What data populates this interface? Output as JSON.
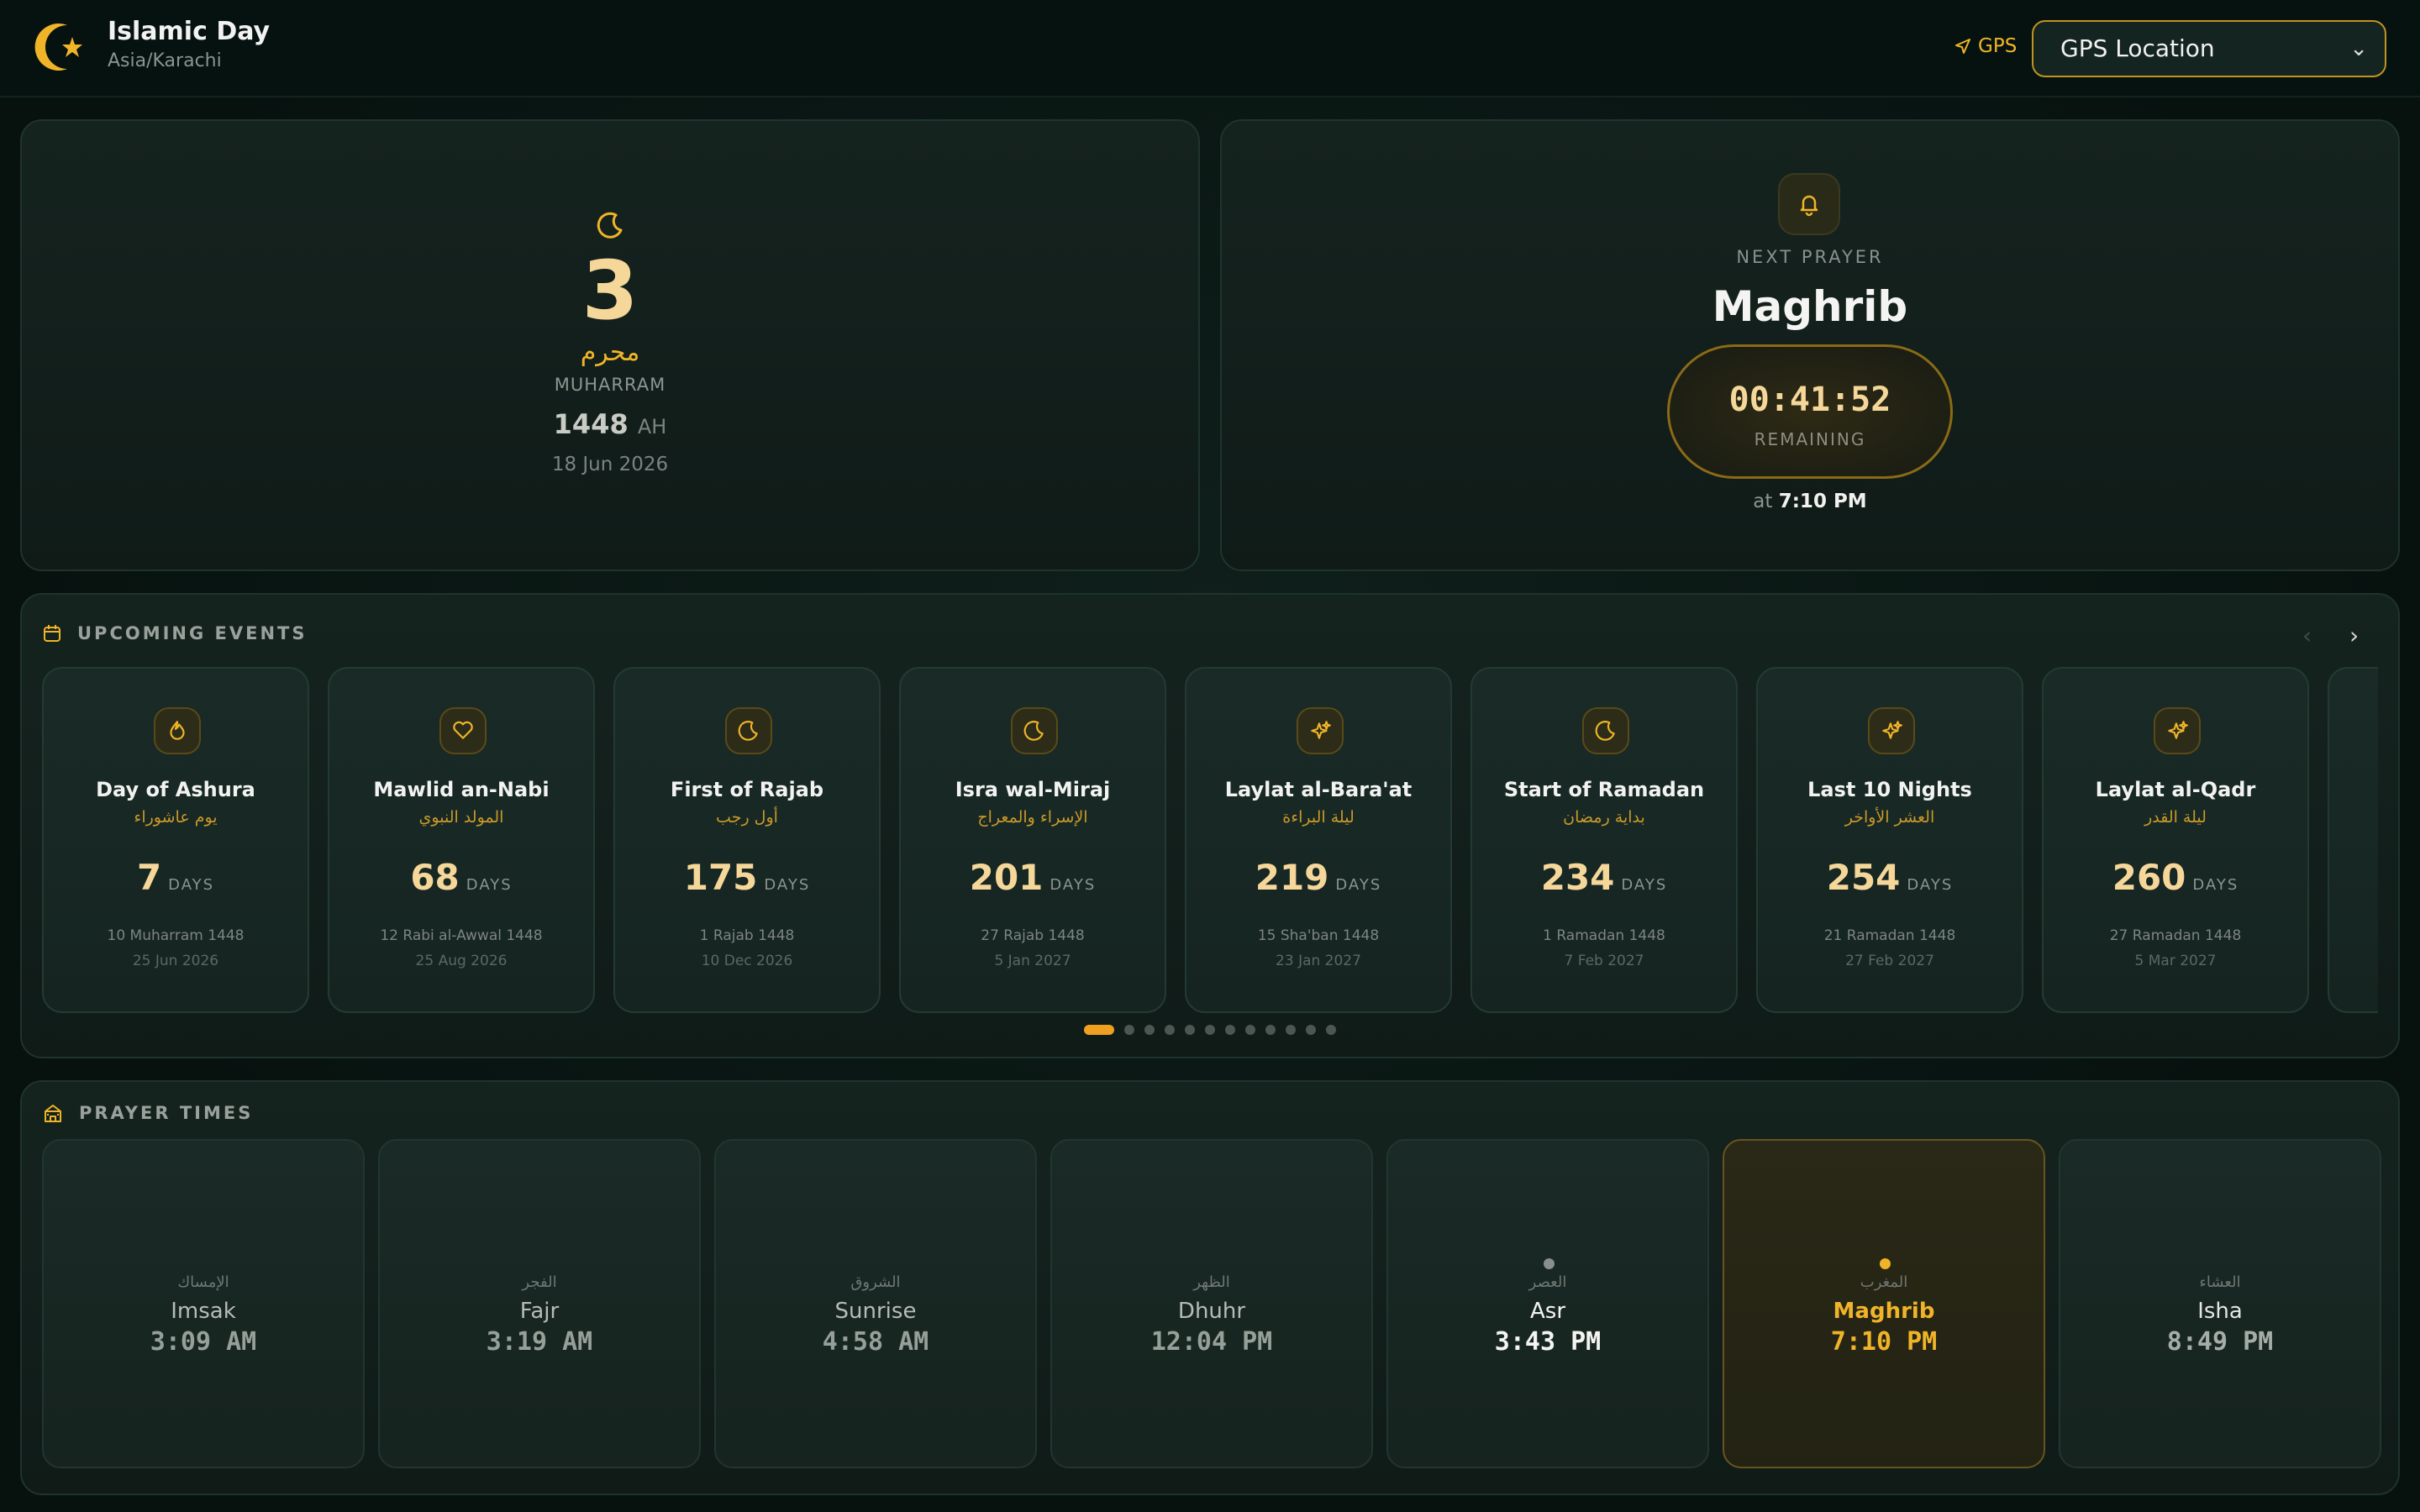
{
  "app": {
    "title": "Islamic Day",
    "timezone": "Asia/Karachi"
  },
  "location": {
    "gps_label": "GPS",
    "selected": "GPS Location"
  },
  "hijri": {
    "day": "3",
    "month_ar": "محرم",
    "month_en": "MUHARRAM",
    "year": "1448",
    "era": "AH",
    "gregorian": "18 Jun 2026"
  },
  "next_prayer": {
    "label": "NEXT PRAYER",
    "name": "Maghrib",
    "countdown": "00:41:52",
    "remaining_label": "REMAINING",
    "at_prefix": "at",
    "at_time": "7:10 PM"
  },
  "events": {
    "title": "UPCOMING EVENTS",
    "days_unit": "DAYS",
    "items": [
      {
        "icon": "flame-icon",
        "name": "Day of Ashura",
        "ar": "يوم عاشوراء",
        "days": "7",
        "hijri": "10 Muharram 1448",
        "greg": "25 Jun 2026"
      },
      {
        "icon": "heart-icon",
        "name": "Mawlid an-Nabi",
        "ar": "المولد النبوي",
        "days": "68",
        "hijri": "12 Rabi al-Awwal 1448",
        "greg": "25 Aug 2026"
      },
      {
        "icon": "moon-icon",
        "name": "First of Rajab",
        "ar": "أول رجب",
        "days": "175",
        "hijri": "1 Rajab 1448",
        "greg": "10 Dec 2026"
      },
      {
        "icon": "moon-icon",
        "name": "Isra wal-Miraj",
        "ar": "الإسراء والمعراج",
        "days": "201",
        "hijri": "27 Rajab 1448",
        "greg": "5 Jan 2027"
      },
      {
        "icon": "sparkles-icon",
        "name": "Laylat al-Bara'at",
        "ar": "ليلة البراءة",
        "days": "219",
        "hijri": "15 Sha'ban 1448",
        "greg": "23 Jan 2027"
      },
      {
        "icon": "moon-icon",
        "name": "Start of Ramadan",
        "ar": "بداية رمضان",
        "days": "234",
        "hijri": "1 Ramadan 1448",
        "greg": "7 Feb 2027"
      },
      {
        "icon": "sparkles-icon",
        "name": "Last 10 Nights",
        "ar": "العشر الأواخر",
        "days": "254",
        "hijri": "21 Ramadan 1448",
        "greg": "27 Feb 2027"
      },
      {
        "icon": "sparkles-icon",
        "name": "Laylat al-Qadr",
        "ar": "ليلة القدر",
        "days": "260",
        "hijri": "27 Ramadan 1448",
        "greg": "5 Mar 2027"
      }
    ],
    "page_count": 12,
    "active_page": 0
  },
  "prayers": {
    "title": "PRAYER TIMES",
    "items": [
      {
        "ar": "الإمساك",
        "name": "Imsak",
        "time": "3:09 AM",
        "state": "past"
      },
      {
        "ar": "الفجر",
        "name": "Fajr",
        "time": "3:19 AM",
        "state": "past"
      },
      {
        "ar": "الشروق",
        "name": "Sunrise",
        "time": "4:58 AM",
        "state": "past"
      },
      {
        "ar": "الظهر",
        "name": "Dhuhr",
        "time": "12:04 PM",
        "state": "past"
      },
      {
        "ar": "العصر",
        "name": "Asr",
        "time": "3:43 PM",
        "state": "now"
      },
      {
        "ar": "المغرب",
        "name": "Maghrib",
        "time": "7:10 PM",
        "state": "next"
      },
      {
        "ar": "العشاء",
        "name": "Isha",
        "time": "8:49 PM",
        "state": "upcoming"
      }
    ]
  },
  "colors": {
    "accent": "#f0b429",
    "accent_light": "#f6d79a",
    "background": "#07120f"
  }
}
